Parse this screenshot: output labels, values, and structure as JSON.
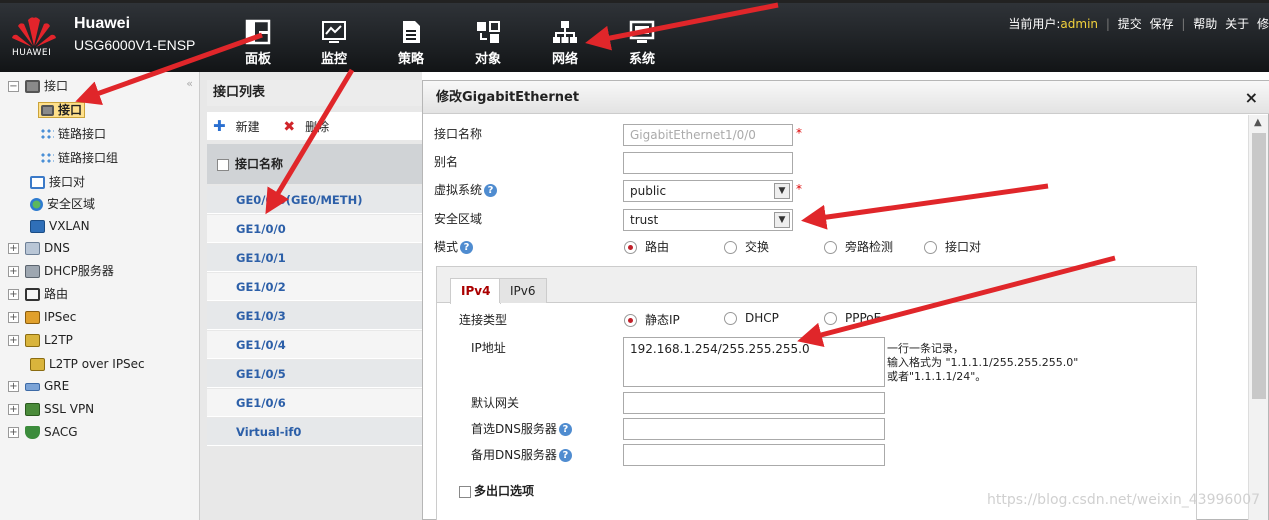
{
  "brand": {
    "logo_text": "HUAWEI",
    "name": "Huawei",
    "model": "USG6000V1-ENSP"
  },
  "nav": [
    {
      "label": "面板",
      "icon": "dashboard-icon"
    },
    {
      "label": "监控",
      "icon": "monitor-icon"
    },
    {
      "label": "策略",
      "icon": "policy-icon"
    },
    {
      "label": "对象",
      "icon": "object-icon"
    },
    {
      "label": "网络",
      "icon": "network-icon"
    },
    {
      "label": "系统",
      "icon": "system-icon"
    }
  ],
  "userbar": {
    "current_user_label": "当前用户:",
    "user": "admin",
    "links": [
      "提交",
      "保存",
      "帮助",
      "关于",
      "修"
    ]
  },
  "tree": {
    "items": [
      {
        "label": "接口",
        "expander": "−"
      },
      {
        "label": "接口",
        "selected": true
      },
      {
        "label": "链路接口"
      },
      {
        "label": "链路接口组"
      },
      {
        "label": "接口对"
      },
      {
        "label": "安全区域"
      },
      {
        "label": "VXLAN"
      },
      {
        "label": "DNS",
        "expander": "+"
      },
      {
        "label": "DHCP服务器",
        "expander": "+"
      },
      {
        "label": "路由",
        "expander": "+"
      },
      {
        "label": "IPSec",
        "expander": "+"
      },
      {
        "label": "L2TP",
        "expander": "+"
      },
      {
        "label": "L2TP over IPSec"
      },
      {
        "label": "GRE",
        "expander": "+"
      },
      {
        "label": "SSL VPN",
        "expander": "+"
      },
      {
        "label": "SACG",
        "expander": "+"
      }
    ],
    "collapse_glyph": "«"
  },
  "list": {
    "title": "接口列表",
    "new_label": "新建",
    "delete_label": "删除",
    "column": "接口名称",
    "rows": [
      "GE0/0/0(GE0/METH)",
      "GE1/0/0",
      "GE1/0/1",
      "GE1/0/2",
      "GE1/0/3",
      "GE1/0/4",
      "GE1/0/5",
      "GE1/0/6",
      "Virtual-if0"
    ]
  },
  "dialog": {
    "title": "修改GigabitEthernet",
    "close": "×",
    "fields": {
      "name_label": "接口名称",
      "name_value": "GigabitEthernet1/0/0",
      "alias_label": "别名",
      "alias_value": "",
      "vsys_label": "虚拟系统",
      "vsys_value": "public",
      "zone_label": "安全区域",
      "zone_value": "trust",
      "mode_label": "模式",
      "mode_options": [
        "路由",
        "交换",
        "旁路检测",
        "接口对"
      ],
      "required_mark": "*"
    },
    "tabs": [
      "IPv4",
      "IPv6"
    ],
    "ipv4": {
      "conn_label": "连接类型",
      "conn_options": [
        "静态IP",
        "DHCP",
        "PPPoE"
      ],
      "ip_label": "IP地址",
      "ip_value": "192.168.1.254/255.255.255.0",
      "ip_hint": [
        "一行一条记录，",
        "输入格式为 \"1.1.1.1/255.255.255.0\"",
        "或者\"1.1.1.1/24\"。"
      ],
      "gateway_label": "默认网关",
      "dns1_label": "首选DNS服务器",
      "dns2_label": "备用DNS服务器",
      "multi_exit_label": "多出口选项"
    }
  },
  "watermark": "https://blog.csdn.net/weixin_43996007",
  "colors": {
    "accent_red": "#c0202a",
    "link_blue": "#2c5fa8",
    "user_yellow": "#f3d23c",
    "arrow_red": "#e0262a"
  }
}
